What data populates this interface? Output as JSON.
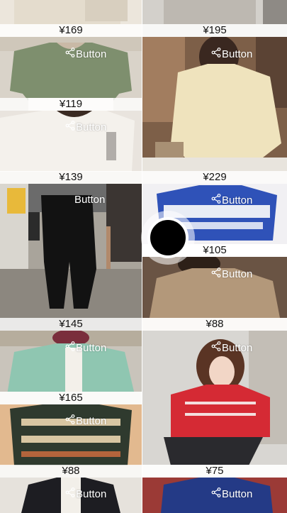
{
  "products": [
    {
      "price": "¥169",
      "button_label": ""
    },
    {
      "price": "¥195",
      "button_label": ""
    },
    {
      "price": "¥119",
      "button_label": "Button"
    },
    {
      "price": "¥139",
      "button_label": "Button"
    },
    {
      "price": "¥229",
      "button_label": "Button"
    },
    {
      "price": "¥105",
      "button_label": "Button"
    },
    {
      "price": "¥145",
      "button_label": "Button"
    },
    {
      "price": "¥88",
      "button_label": "Button"
    },
    {
      "price": "¥165",
      "button_label": "Button"
    },
    {
      "price": "¥75",
      "button_label": "Button"
    },
    {
      "price": "¥88",
      "button_label": "Button"
    },
    {
      "price": "",
      "button_label": "Button"
    },
    {
      "price": "",
      "button_label": "Button"
    }
  ],
  "colors": {
    "price_bar": "#ffffff",
    "button_text": "#ffffff",
    "floating_button": "#000000"
  },
  "icons": {
    "share": "share-icon"
  }
}
